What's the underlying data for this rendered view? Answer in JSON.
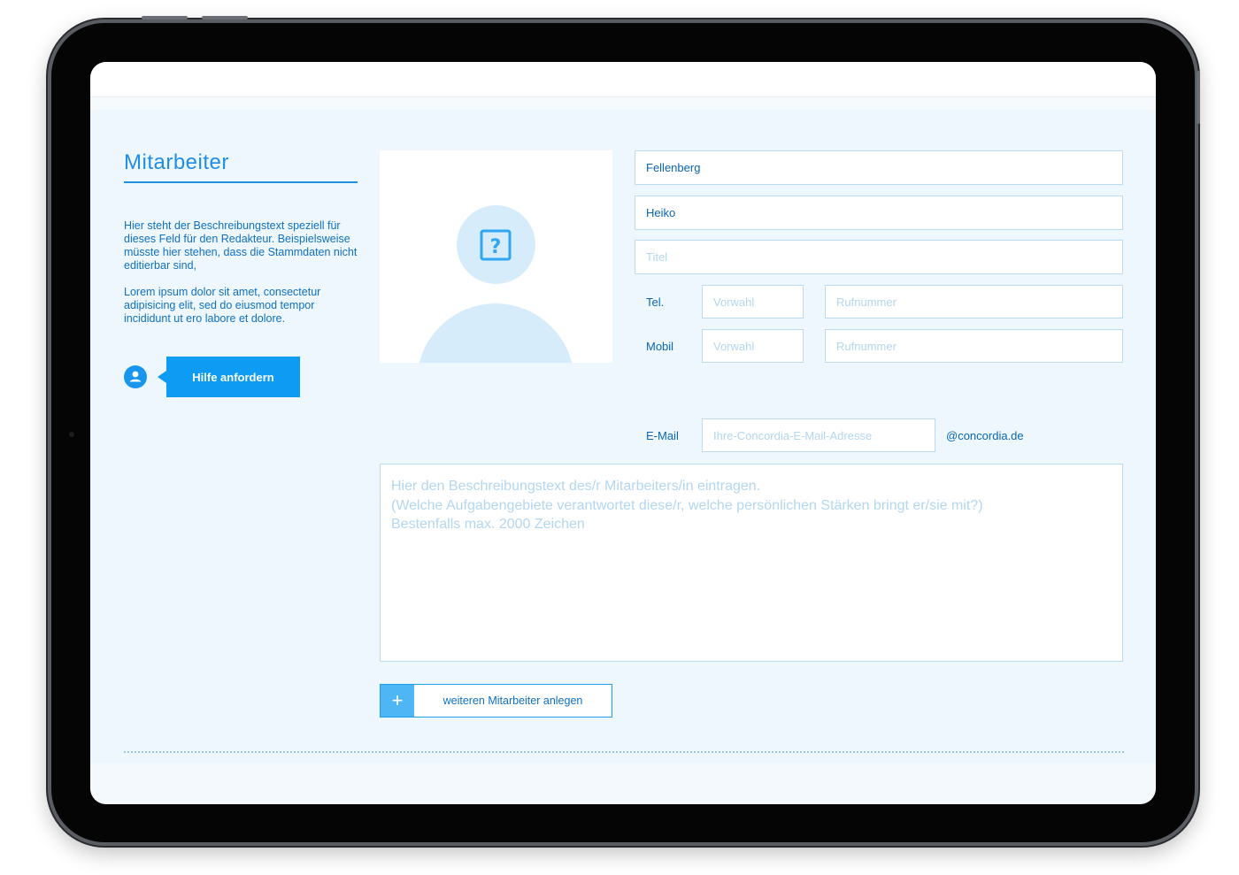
{
  "sidebar": {
    "title": "Mitarbeiter",
    "description_1": "Hier steht der Beschreibungstext speziell für dieses Feld für den Redakteur. Beispielsweise müsste hier stehen, dass die Stammdaten nicht editierbar sind,",
    "description_2": "Lorem ipsum dolor sit amet, consectetur adipisicing elit, sed do eiusmod tempor incididunt ut ero labore et dolore.",
    "help_button": "Hilfe anfordern"
  },
  "form": {
    "last_name": "Fellenberg",
    "first_name": "Heiko",
    "title_placeholder": "Titel",
    "tel_label": "Tel.",
    "mobile_label": "Mobil",
    "area_code_placeholder": "Vorwahl",
    "number_placeholder": "Rufnummer",
    "email_label": "E-Mail",
    "email_placeholder": "Ihre-Concordia-E-Mail-Adresse",
    "email_domain": "@concordia.de",
    "description_placeholder": "Hier den Beschreibungstext des/r Mitarbeiters/in eintragen.\n(Welche Aufgabengebiete verantwortet diese/r, welche persönlichen Stärken bringt er/sie mit?)\nBestenfalls max. 2000 Zeichen"
  },
  "add_employee": {
    "plus": "+",
    "label": "weiteren Mitarbeiter anlegen"
  },
  "colors": {
    "accent": "#0d9bf3",
    "text_blue": "#0b66b4",
    "placeholder": "#b3d7f1",
    "background": "#eef7fe"
  },
  "icons": [
    "user-icon",
    "question-mark-icon",
    "plus-icon"
  ]
}
